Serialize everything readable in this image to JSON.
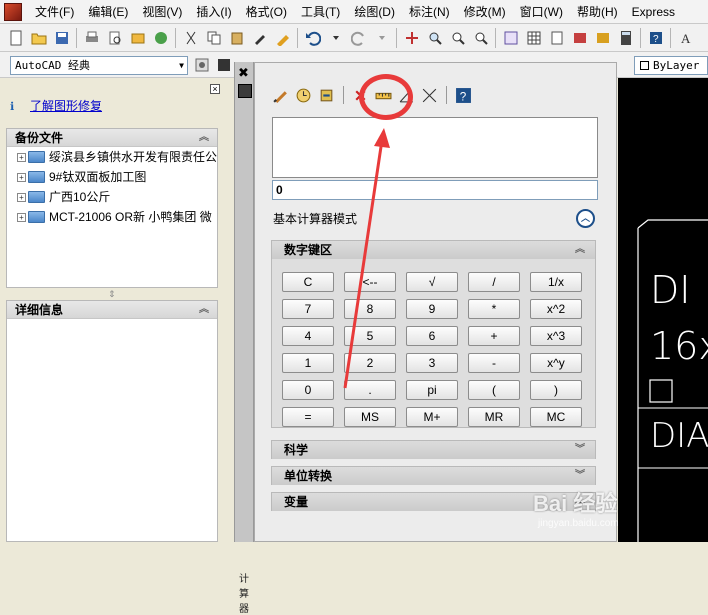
{
  "menubar": {
    "items": [
      "文件(F)",
      "编辑(E)",
      "视图(V)",
      "插入(I)",
      "格式(O)",
      "工具(T)",
      "绘图(D)",
      "标注(N)",
      "修改(M)",
      "窗口(W)",
      "帮助(H)",
      "Express"
    ]
  },
  "toolbar2": {
    "workspace": "AutoCAD 经典",
    "layer_value": "ByLayer"
  },
  "left_panel": {
    "repair_link": "了解图形修复",
    "backup_title": "备份文件",
    "backup_files": [
      "绥滨县乡镇供水开发有限责任公",
      "9#钛双面板加工图",
      "广西10公斤",
      "MCT-21006 OR新 小鸭集团 微"
    ],
    "details_title": "详细信息"
  },
  "calculator": {
    "entry_value": "0",
    "mode_label": "基本计算器模式",
    "keypad_title": "数字键区",
    "keys": [
      [
        "C",
        "<--",
        "√",
        "/",
        "1/x"
      ],
      [
        "7",
        "8",
        "9",
        "*",
        "x^2"
      ],
      [
        "4",
        "5",
        "6",
        "+",
        "x^3"
      ],
      [
        "1",
        "2",
        "3",
        "-",
        "x^y"
      ],
      [
        "0",
        ".",
        "pi",
        "(",
        ")"
      ],
      [
        "=",
        "MS",
        "M+",
        "MR",
        "MC"
      ]
    ],
    "science_title": "科学",
    "units_title": "单位转换",
    "variables_title": "变量"
  },
  "dock": {
    "label": "计算器"
  },
  "drawing": {
    "texts": [
      "DI",
      "16x",
      "DIA("
    ]
  },
  "watermark": {
    "text": "Bai 经验",
    "sub": "jingyan.baidu.com"
  },
  "colors": {
    "annotation": "#e83a3a",
    "link": "#0000cc",
    "canvas": "#000000"
  }
}
